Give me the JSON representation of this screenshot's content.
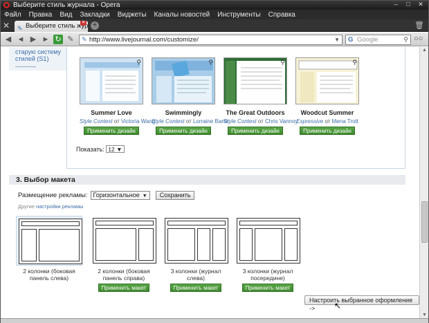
{
  "window": {
    "title": "Выберите стиль журнала - Opera"
  },
  "menu": [
    "Файл",
    "Правка",
    "Вид",
    "Закладки",
    "Виджеты",
    "Каналы новостей",
    "Инструменты",
    "Справка"
  ],
  "tab": {
    "title": "Выберите стиль журн..."
  },
  "address": {
    "url": "http://www.livejournal.com/customize/"
  },
  "search": {
    "placeholder": "Google"
  },
  "sidebar": {
    "link1": "старую систему",
    "link2": "стилей (S1)"
  },
  "themes": [
    {
      "name": "Summer Love",
      "category": "Style Contest",
      "by": "от",
      "author": "Victoria Wang",
      "button": "Применить дизайн",
      "color": "#cfe3f3"
    },
    {
      "name": "Swimmingly",
      "category": "Style Contest",
      "by": "от",
      "author": "Lorraine Barte",
      "button": "Применить дизайн",
      "color": "#a9cde8"
    },
    {
      "name": "The Great Outdoors",
      "category": "Style Contest",
      "by": "от",
      "author": "Chris Vannoy",
      "button": "Применить дизайн",
      "color": "#2f6e35"
    },
    {
      "name": "Woodcut Summer",
      "category": "Expressive",
      "by": "от",
      "author": "Mena Trott",
      "button": "Применить дизайн",
      "color": "#efe8c0"
    }
  ],
  "show": {
    "label": "Показать:",
    "value": "12"
  },
  "section": {
    "title": "3. Выбор макета"
  },
  "ads": {
    "label": "Размещение рекламы:",
    "value": "Горизонтальное",
    "save": "Сохранить",
    "other_prefix": "Другие",
    "other_link": "настройки рекламы"
  },
  "layouts": [
    {
      "label": "2 колонки (боковая панель слева)",
      "button": ""
    },
    {
      "label": "2 колонки (боковая панель справа)",
      "button": "Применить макет"
    },
    {
      "label": "3 колонки (журнал слева)",
      "button": "Применить макет"
    },
    {
      "label": "3 колонки (журнал посередине)",
      "button": "Применить макет"
    }
  ],
  "customize_button": "Настроить выбранное оформление ->"
}
